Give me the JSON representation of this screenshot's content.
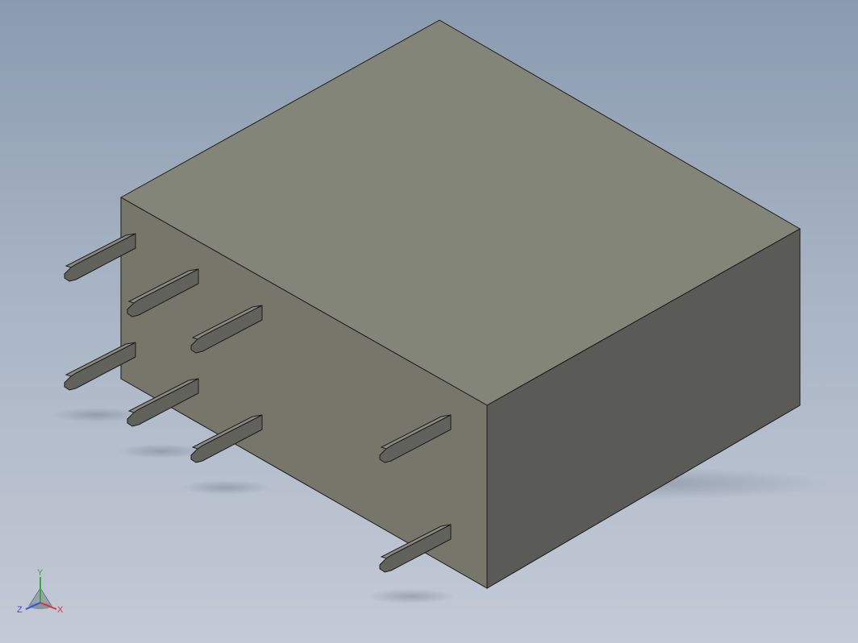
{
  "viewport": {
    "background_top": "#8a9bb0",
    "background_bottom": "#c4cad6"
  },
  "model": {
    "top_face_color": "#848579",
    "front_face_color": "#76766a",
    "side_face_color": "#5a5a56",
    "edge_color": "#1c1c1c",
    "pin_count": 8
  },
  "triad": {
    "x_label": "X",
    "y_label": "Y",
    "z_label": "Z",
    "x_color": "#e03030",
    "y_color": "#30b030",
    "z_color": "#3050e0"
  }
}
